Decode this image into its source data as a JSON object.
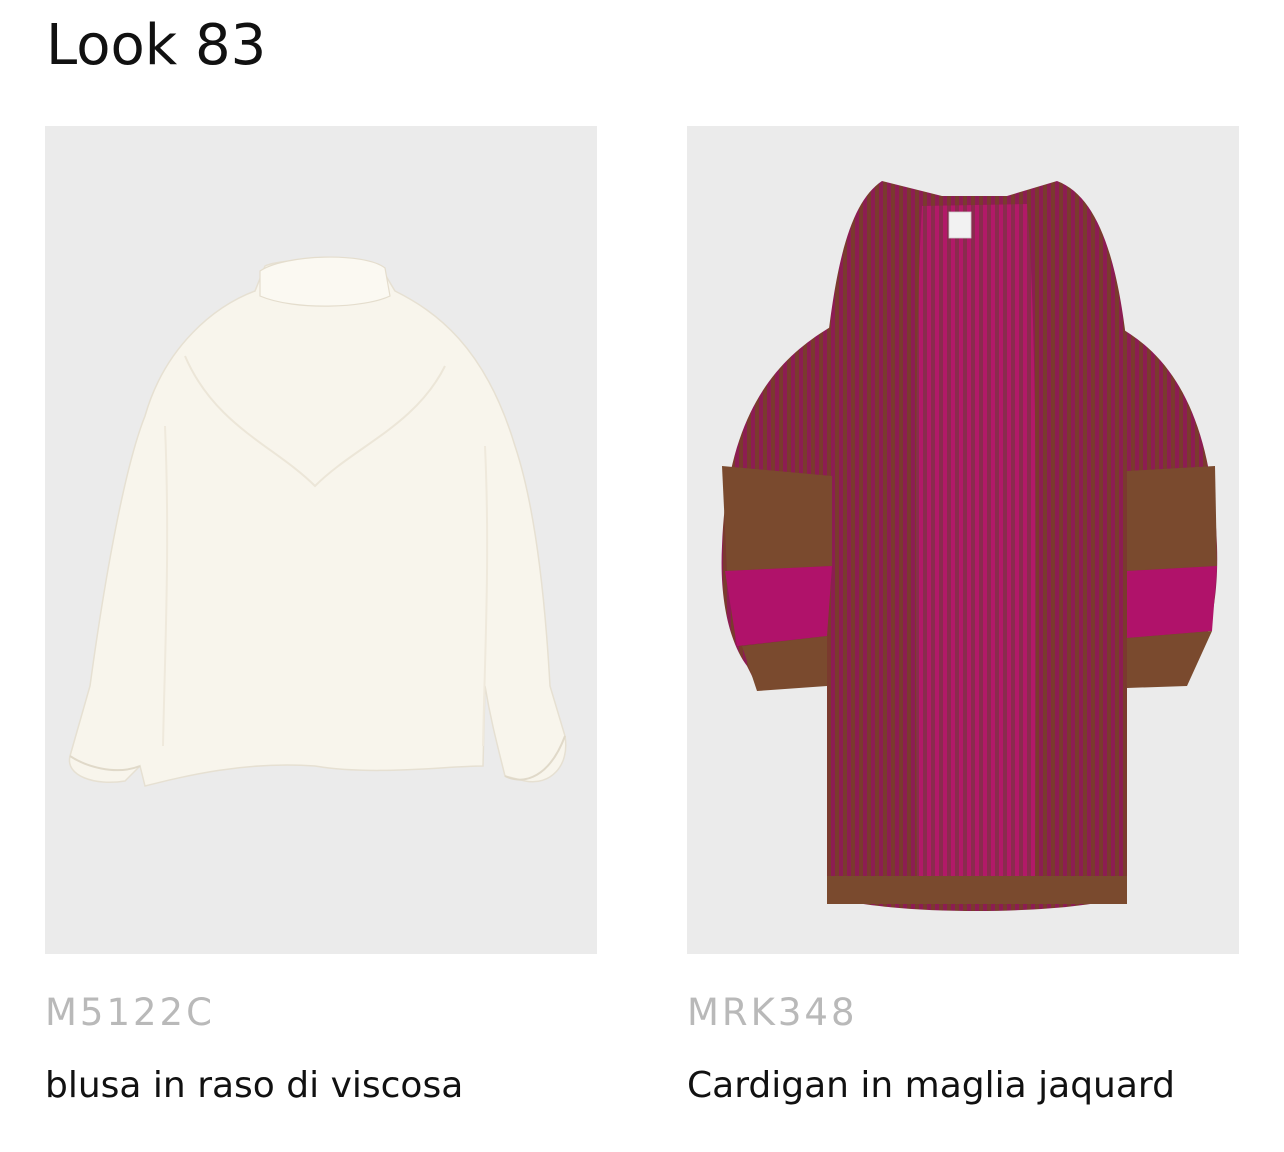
{
  "page": {
    "title": "Look 83"
  },
  "products": [
    {
      "code": "M5122C",
      "name": "blusa in raso di viscosa",
      "image_icon": "white-satin-blouse-photo",
      "image_background": "#ebebeb"
    },
    {
      "code": "MRK348",
      "name": "Cardigan in maglia jaquard",
      "image_icon": "ribbed-knit-cardigan-photo",
      "image_background": "#ebebeb"
    }
  ],
  "colors": {
    "code_text": "#b9b9b9",
    "name_text": "#111111",
    "blouse": "#f8f5ec",
    "cardigan_magenta": "#8c1d52",
    "cardigan_brown": "#7a4a2e",
    "cardigan_pink_band": "#b0126a"
  }
}
